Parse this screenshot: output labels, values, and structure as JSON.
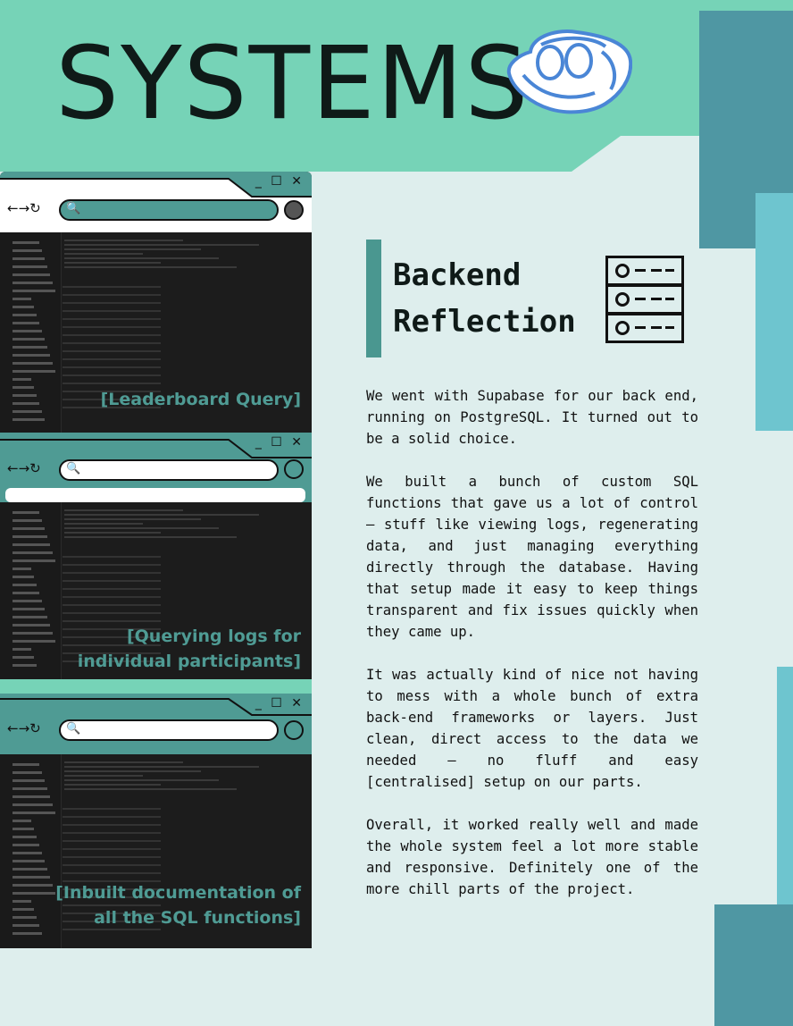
{
  "header": {
    "title": "SYSTEMS"
  },
  "windows": [
    {
      "caption_lines": [
        "[Leaderboard Query]"
      ]
    },
    {
      "caption_lines": [
        "[Querying logs for",
        "individual participants]"
      ]
    },
    {
      "caption_lines": [
        "[Inbuilt documentation of",
        "all the SQL functions]"
      ]
    }
  ],
  "section": {
    "title_lines": [
      "Backend",
      "Reflection"
    ],
    "paragraphs": [
      "We went with Supabase for our back end, running on PostgreSQL. It turned out to be a solid choice.",
      "We built a bunch of custom SQL functions that gave us a lot of control — stuff like viewing logs, regenerating data, and just managing everything directly through the database. Having that setup made it easy to keep things transparent and fix issues quickly when they came up.",
      "It was actually kind of nice not having to mess with a whole bunch of extra back-end frameworks or layers. Just clean, direct access to the data we needed — no fluff and easy [centralised] setup on our parts.",
      "Overall, it worked really well and made the whole system feel a lot more stable and responsive. Definitely one of the more chill parts of the project."
    ]
  },
  "colors": {
    "header_teal": "#76d3b7",
    "background": "#deeeed",
    "dark_teal": "#4f97a3",
    "light_blue": "#6ec5cf",
    "accent_bar": "#4a9790",
    "caption": "#4f9b94"
  },
  "icons": [
    "mascot-logo",
    "server-stack-icon",
    "search-icon",
    "minimize-icon",
    "maximize-icon",
    "close-icon",
    "back-arrow-icon",
    "forward-arrow-icon",
    "reload-icon"
  ]
}
